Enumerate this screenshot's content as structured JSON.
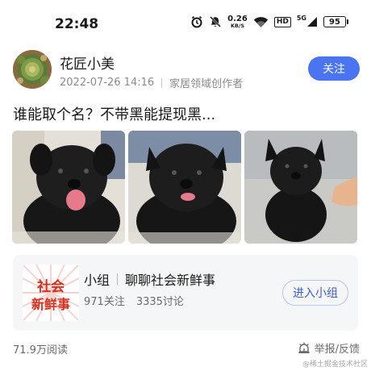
{
  "status_bar": {
    "time": "22:48",
    "net_speed_value": "0.26",
    "net_speed_unit": "KB/S",
    "hd_label": "HD",
    "network_label": "5G",
    "battery_level": "95",
    "icons": [
      "alarm-icon",
      "mute-icon",
      "wifi-icon",
      "signal-icon",
      "battery-icon"
    ]
  },
  "author": {
    "name": "花匠小美",
    "date": "2022-07-26 14:16",
    "role": "家居领域创作者",
    "follow_label": "关注",
    "accent_color": "#4a74f0"
  },
  "post": {
    "title": "谁能取个名？不带黑能提现黑..."
  },
  "photos": [
    {
      "subject": "black-puppy-tongue-out"
    },
    {
      "subject": "black-puppy-front"
    },
    {
      "subject": "black-puppy-sitting"
    }
  ],
  "group": {
    "logo_text": "社会新鲜事",
    "logo_line1": "社会",
    "logo_line2": "新鲜事",
    "label": "小组",
    "name": "聊聊社会新鲜事",
    "members": "971关注",
    "discussions": "3335讨论",
    "enter_label": "进入小组"
  },
  "footer": {
    "views": "71.9万阅读",
    "report_label": "举报/反馈"
  },
  "watermark": "@稀土掘金技术社区"
}
